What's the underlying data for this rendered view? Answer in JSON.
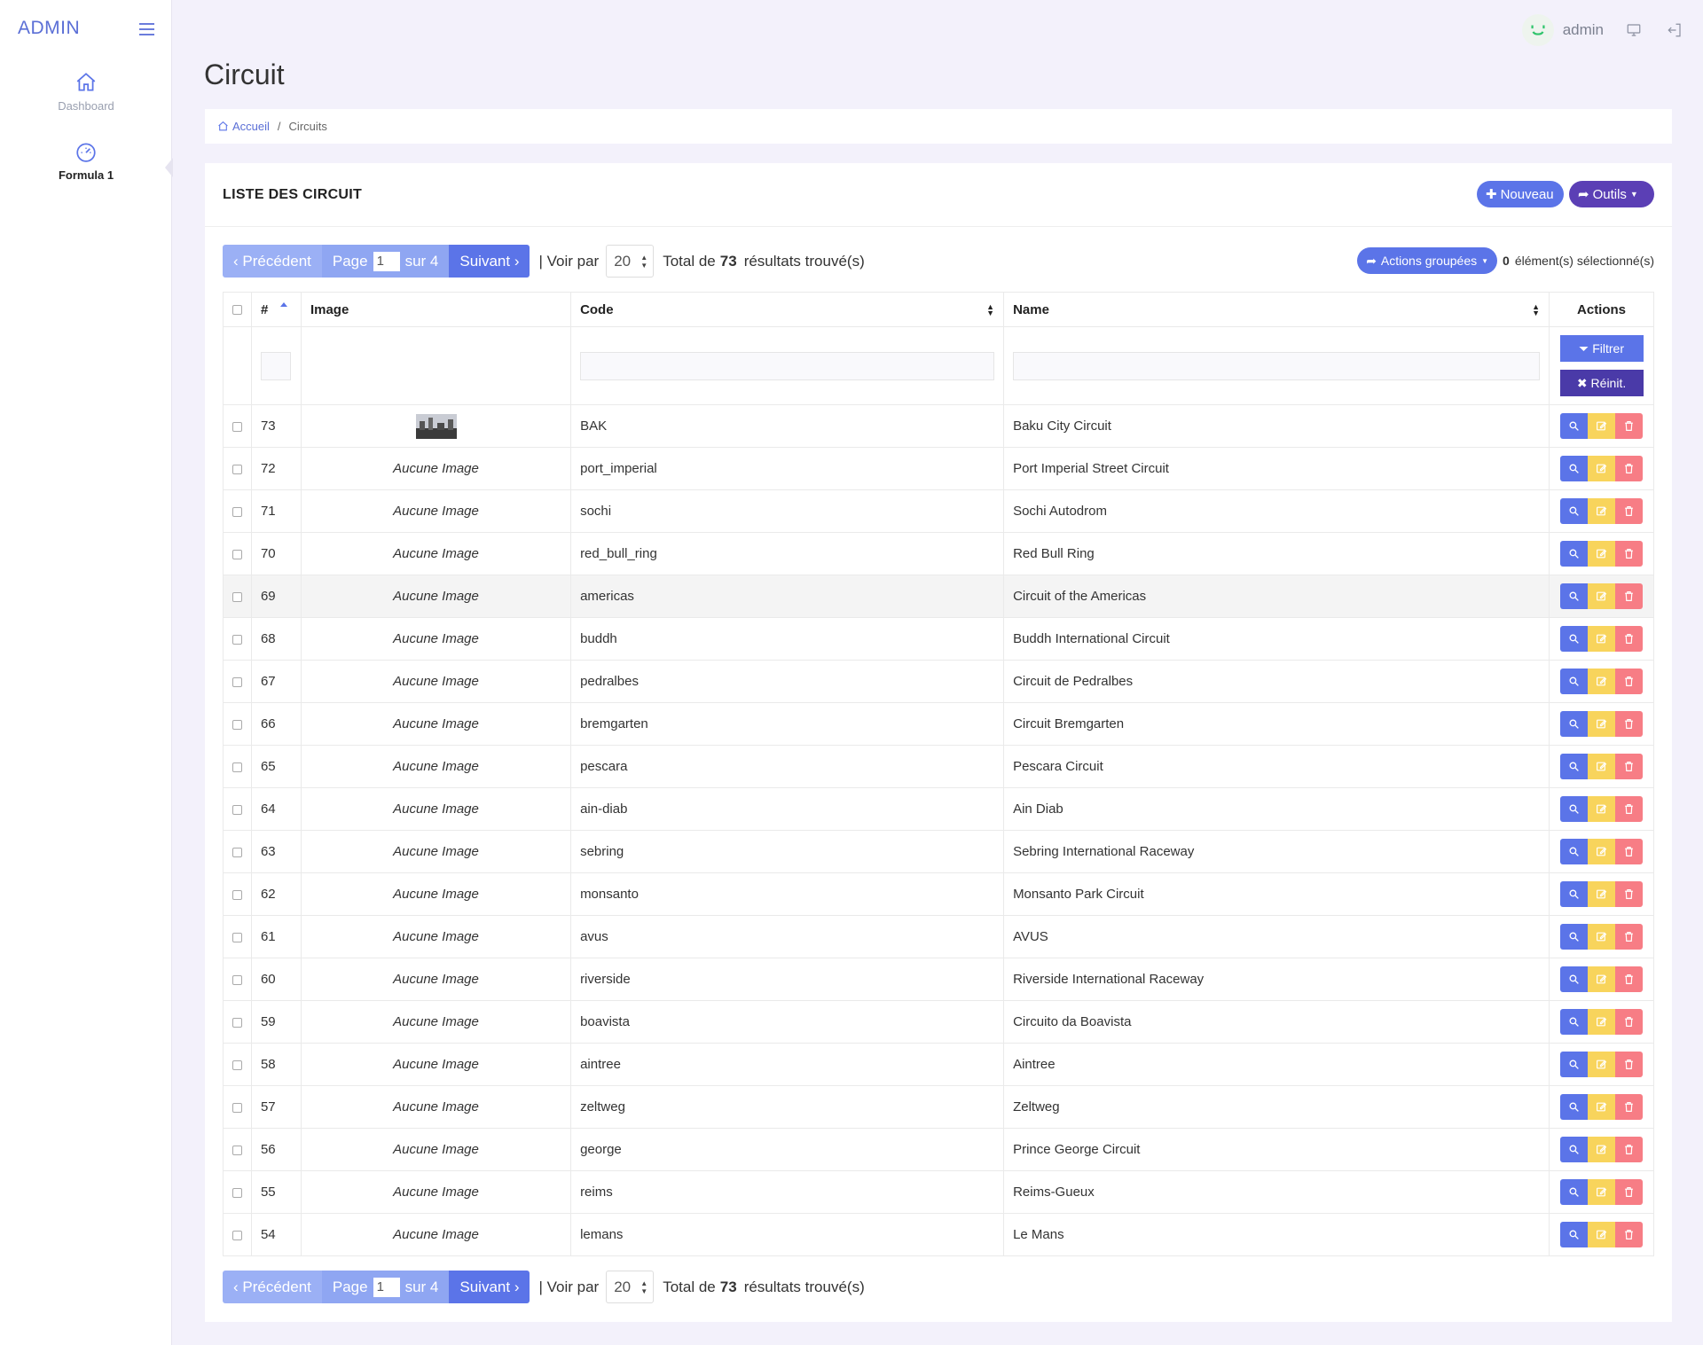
{
  "app": {
    "brand": "ADMIN"
  },
  "sidebar": {
    "items": [
      {
        "label": "Dashboard",
        "icon": "home-icon"
      },
      {
        "label": "Formula 1",
        "icon": "speedometer-icon"
      }
    ]
  },
  "topbar": {
    "user": "admin"
  },
  "page": {
    "title": "Circuit"
  },
  "breadcrumb": {
    "home": "Accueil",
    "sep": "/",
    "current": "Circuits"
  },
  "card": {
    "title": "LISTE DES CIRCUIT",
    "new_label": "Nouveau",
    "tools_label": "Outils"
  },
  "pager": {
    "prev": "‹ Précédent",
    "page_label": "Page",
    "page_value": "1",
    "of_label": "sur 4",
    "next": "Suivant ›",
    "per_label": "| Voir par",
    "per_value": "20",
    "total_prefix": "Total de",
    "total": "73",
    "total_suffix": "résultats trouvé(s)"
  },
  "bulk": {
    "label": "Actions groupées",
    "count": "0",
    "count_suffix": "élément(s) sélectionné(s)"
  },
  "table": {
    "headers": {
      "id": "#",
      "image": "Image",
      "code": "Code",
      "name": "Name",
      "actions": "Actions"
    },
    "filter_label": "Filtrer",
    "reset_label": "Réinit.",
    "no_image": "Aucune Image",
    "rows": [
      {
        "id": "73",
        "image": "",
        "code": "BAK",
        "name": "Baku City Circuit"
      },
      {
        "id": "72",
        "image": "Aucune Image",
        "code": "port_imperial",
        "name": "Port Imperial Street Circuit"
      },
      {
        "id": "71",
        "image": "Aucune Image",
        "code": "sochi",
        "name": "Sochi Autodrom"
      },
      {
        "id": "70",
        "image": "Aucune Image",
        "code": "red_bull_ring",
        "name": "Red Bull Ring"
      },
      {
        "id": "69",
        "image": "Aucune Image",
        "code": "americas",
        "name": "Circuit of the Americas"
      },
      {
        "id": "68",
        "image": "Aucune Image",
        "code": "buddh",
        "name": "Buddh International Circuit"
      },
      {
        "id": "67",
        "image": "Aucune Image",
        "code": "pedralbes",
        "name": "Circuit de Pedralbes"
      },
      {
        "id": "66",
        "image": "Aucune Image",
        "code": "bremgarten",
        "name": "Circuit Bremgarten"
      },
      {
        "id": "65",
        "image": "Aucune Image",
        "code": "pescara",
        "name": "Pescara Circuit"
      },
      {
        "id": "64",
        "image": "Aucune Image",
        "code": "ain-diab",
        "name": "Ain Diab"
      },
      {
        "id": "63",
        "image": "Aucune Image",
        "code": "sebring",
        "name": "Sebring International Raceway"
      },
      {
        "id": "62",
        "image": "Aucune Image",
        "code": "monsanto",
        "name": "Monsanto Park Circuit"
      },
      {
        "id": "61",
        "image": "Aucune Image",
        "code": "avus",
        "name": "AVUS"
      },
      {
        "id": "60",
        "image": "Aucune Image",
        "code": "riverside",
        "name": "Riverside International Raceway"
      },
      {
        "id": "59",
        "image": "Aucune Image",
        "code": "boavista",
        "name": "Circuito da Boavista"
      },
      {
        "id": "58",
        "image": "Aucune Image",
        "code": "aintree",
        "name": "Aintree"
      },
      {
        "id": "57",
        "image": "Aucune Image",
        "code": "zeltweg",
        "name": "Zeltweg"
      },
      {
        "id": "56",
        "image": "Aucune Image",
        "code": "george",
        "name": "Prince George Circuit"
      },
      {
        "id": "55",
        "image": "Aucune Image",
        "code": "reims",
        "name": "Reims-Gueux"
      },
      {
        "id": "54",
        "image": "Aucune Image",
        "code": "lemans",
        "name": "Le Mans"
      }
    ]
  },
  "colors": {
    "primary": "#5b74e8",
    "secondary": "#5b3fb5",
    "warning": "#f8d45c",
    "danger": "#f77d85",
    "background": "#f3f1fb"
  }
}
